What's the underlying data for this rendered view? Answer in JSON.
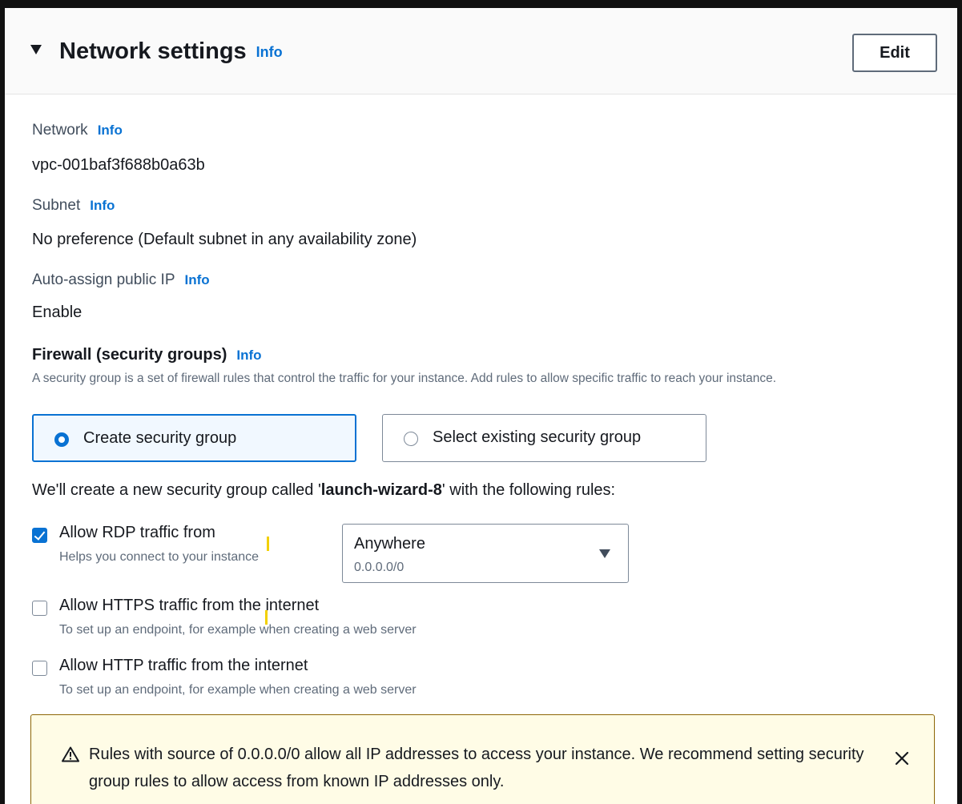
{
  "header": {
    "title": "Network settings",
    "info": "Info",
    "edit_label": "Edit"
  },
  "network": {
    "label": "Network",
    "info": "Info",
    "value": "vpc-001baf3f688b0a63b"
  },
  "subnet": {
    "label": "Subnet",
    "info": "Info",
    "value": "No preference (Default subnet in any availability zone)"
  },
  "auto_ip": {
    "label": "Auto-assign public IP",
    "info": "Info",
    "value": "Enable"
  },
  "firewall": {
    "title": "Firewall (security groups)",
    "info": "Info",
    "description": "A security group is a set of firewall rules that control the traffic for your instance. Add rules to allow specific traffic to reach your instance.",
    "options": [
      {
        "label": "Create security group",
        "selected": true
      },
      {
        "label": "Select existing security group",
        "selected": false
      }
    ],
    "note_prefix": "We'll create a new security group called '",
    "note_name": "launch-wizard-8",
    "note_suffix": "' with the following rules:"
  },
  "rules": [
    {
      "label": "Allow RDP traffic from",
      "description": "Helps you connect to your instance",
      "checked": true
    },
    {
      "label": "Allow HTTPS traffic from the internet",
      "description": "To set up an endpoint, for example when creating a web server",
      "checked": false
    },
    {
      "label": "Allow HTTP traffic from the internet",
      "description": "To set up an endpoint, for example when creating a web server",
      "checked": false
    }
  ],
  "source_select": {
    "value": "Anywhere",
    "sub": "0.0.0.0/0"
  },
  "alert": {
    "text": "Rules with source of 0.0.0.0/0 allow all IP addresses to access your instance. We recommend setting security group rules to allow access from known IP addresses only."
  },
  "colors": {
    "accent": "#0972d3",
    "warning_bg": "#fffce6",
    "warning_border": "#8d6605",
    "highlight_mark": "#f2d000"
  },
  "icons": {
    "collapse": "caret-down-icon",
    "warning": "warning-icon",
    "close": "close-icon",
    "dropdown": "dropdown-caret-icon"
  }
}
